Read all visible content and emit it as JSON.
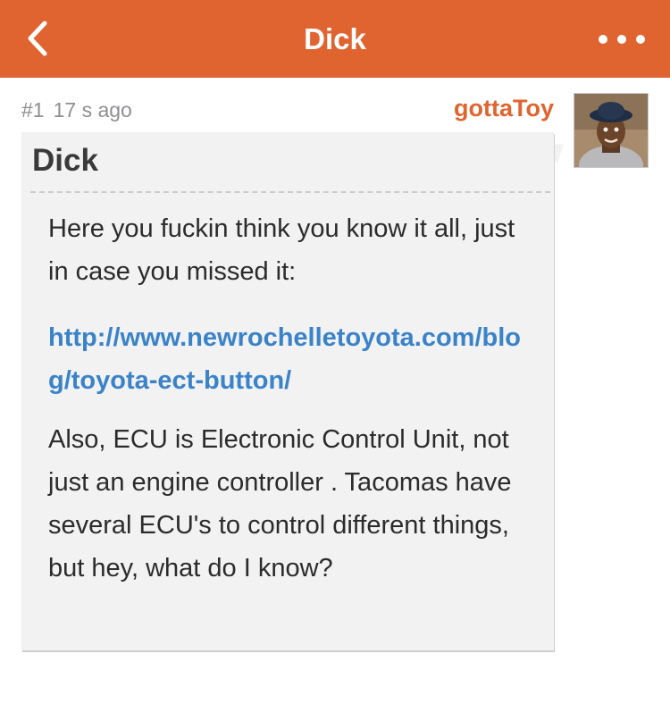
{
  "header": {
    "title": "Dick",
    "back_icon": "chevron-left-icon",
    "more_icon": "more-horizontal-icon",
    "color": "#e06430"
  },
  "post": {
    "number": "#1",
    "time": "17 s ago",
    "author": "gottaToy",
    "title": "Dick",
    "paragraph1": "Here you fuckin think you know it all, just in case you missed it:",
    "link": "http://www.newrochelletoyota.com/blog/toyota-ect-button/",
    "paragraph2": "Also, ECU is Electronic Control Unit, not just an engine controller . Tacomas have several ECU's to control different things, but hey, what do I know?"
  },
  "colors": {
    "accent": "#e06430",
    "link": "#3b83c9",
    "bubble": "#f2f2f2"
  }
}
